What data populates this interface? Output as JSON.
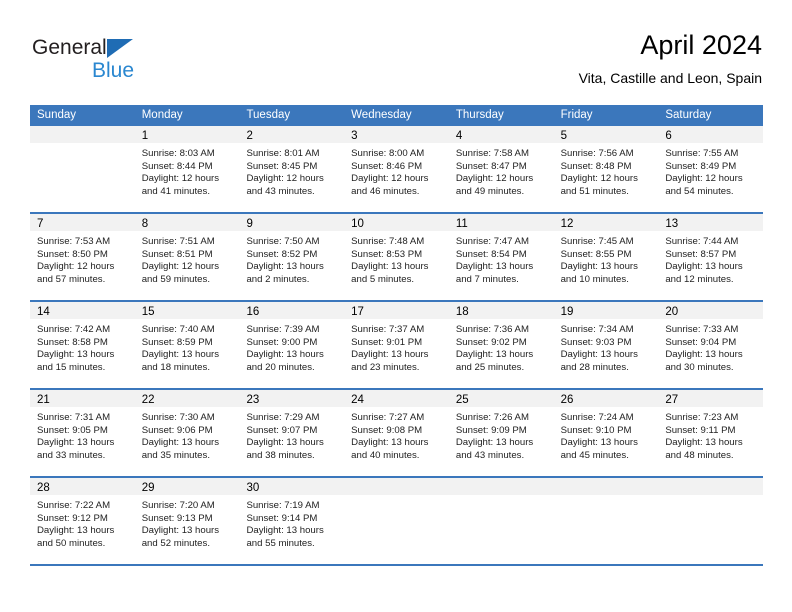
{
  "brand": {
    "name_top": "General",
    "name_bottom": "Blue"
  },
  "header": {
    "title": "April 2024",
    "location": "Vita, Castille and Leon, Spain"
  },
  "colors": {
    "header_blue": "#3b77bc",
    "logo_blue": "#2a87d0",
    "daynum_band": "#f2f2f2"
  },
  "weekdays": [
    "Sunday",
    "Monday",
    "Tuesday",
    "Wednesday",
    "Thursday",
    "Friday",
    "Saturday"
  ],
  "weeks": [
    [
      {
        "day": "",
        "lines": [
          "",
          "",
          "",
          ""
        ]
      },
      {
        "day": "1",
        "lines": [
          "Sunrise: 8:03 AM",
          "Sunset: 8:44 PM",
          "Daylight: 12 hours",
          "and 41 minutes."
        ]
      },
      {
        "day": "2",
        "lines": [
          "Sunrise: 8:01 AM",
          "Sunset: 8:45 PM",
          "Daylight: 12 hours",
          "and 43 minutes."
        ]
      },
      {
        "day": "3",
        "lines": [
          "Sunrise: 8:00 AM",
          "Sunset: 8:46 PM",
          "Daylight: 12 hours",
          "and 46 minutes."
        ]
      },
      {
        "day": "4",
        "lines": [
          "Sunrise: 7:58 AM",
          "Sunset: 8:47 PM",
          "Daylight: 12 hours",
          "and 49 minutes."
        ]
      },
      {
        "day": "5",
        "lines": [
          "Sunrise: 7:56 AM",
          "Sunset: 8:48 PM",
          "Daylight: 12 hours",
          "and 51 minutes."
        ]
      },
      {
        "day": "6",
        "lines": [
          "Sunrise: 7:55 AM",
          "Sunset: 8:49 PM",
          "Daylight: 12 hours",
          "and 54 minutes."
        ]
      }
    ],
    [
      {
        "day": "7",
        "lines": [
          "Sunrise: 7:53 AM",
          "Sunset: 8:50 PM",
          "Daylight: 12 hours",
          "and 57 minutes."
        ]
      },
      {
        "day": "8",
        "lines": [
          "Sunrise: 7:51 AM",
          "Sunset: 8:51 PM",
          "Daylight: 12 hours",
          "and 59 minutes."
        ]
      },
      {
        "day": "9",
        "lines": [
          "Sunrise: 7:50 AM",
          "Sunset: 8:52 PM",
          "Daylight: 13 hours",
          "and 2 minutes."
        ]
      },
      {
        "day": "10",
        "lines": [
          "Sunrise: 7:48 AM",
          "Sunset: 8:53 PM",
          "Daylight: 13 hours",
          "and 5 minutes."
        ]
      },
      {
        "day": "11",
        "lines": [
          "Sunrise: 7:47 AM",
          "Sunset: 8:54 PM",
          "Daylight: 13 hours",
          "and 7 minutes."
        ]
      },
      {
        "day": "12",
        "lines": [
          "Sunrise: 7:45 AM",
          "Sunset: 8:55 PM",
          "Daylight: 13 hours",
          "and 10 minutes."
        ]
      },
      {
        "day": "13",
        "lines": [
          "Sunrise: 7:44 AM",
          "Sunset: 8:57 PM",
          "Daylight: 13 hours",
          "and 12 minutes."
        ]
      }
    ],
    [
      {
        "day": "14",
        "lines": [
          "Sunrise: 7:42 AM",
          "Sunset: 8:58 PM",
          "Daylight: 13 hours",
          "and 15 minutes."
        ]
      },
      {
        "day": "15",
        "lines": [
          "Sunrise: 7:40 AM",
          "Sunset: 8:59 PM",
          "Daylight: 13 hours",
          "and 18 minutes."
        ]
      },
      {
        "day": "16",
        "lines": [
          "Sunrise: 7:39 AM",
          "Sunset: 9:00 PM",
          "Daylight: 13 hours",
          "and 20 minutes."
        ]
      },
      {
        "day": "17",
        "lines": [
          "Sunrise: 7:37 AM",
          "Sunset: 9:01 PM",
          "Daylight: 13 hours",
          "and 23 minutes."
        ]
      },
      {
        "day": "18",
        "lines": [
          "Sunrise: 7:36 AM",
          "Sunset: 9:02 PM",
          "Daylight: 13 hours",
          "and 25 minutes."
        ]
      },
      {
        "day": "19",
        "lines": [
          "Sunrise: 7:34 AM",
          "Sunset: 9:03 PM",
          "Daylight: 13 hours",
          "and 28 minutes."
        ]
      },
      {
        "day": "20",
        "lines": [
          "Sunrise: 7:33 AM",
          "Sunset: 9:04 PM",
          "Daylight: 13 hours",
          "and 30 minutes."
        ]
      }
    ],
    [
      {
        "day": "21",
        "lines": [
          "Sunrise: 7:31 AM",
          "Sunset: 9:05 PM",
          "Daylight: 13 hours",
          "and 33 minutes."
        ]
      },
      {
        "day": "22",
        "lines": [
          "Sunrise: 7:30 AM",
          "Sunset: 9:06 PM",
          "Daylight: 13 hours",
          "and 35 minutes."
        ]
      },
      {
        "day": "23",
        "lines": [
          "Sunrise: 7:29 AM",
          "Sunset: 9:07 PM",
          "Daylight: 13 hours",
          "and 38 minutes."
        ]
      },
      {
        "day": "24",
        "lines": [
          "Sunrise: 7:27 AM",
          "Sunset: 9:08 PM",
          "Daylight: 13 hours",
          "and 40 minutes."
        ]
      },
      {
        "day": "25",
        "lines": [
          "Sunrise: 7:26 AM",
          "Sunset: 9:09 PM",
          "Daylight: 13 hours",
          "and 43 minutes."
        ]
      },
      {
        "day": "26",
        "lines": [
          "Sunrise: 7:24 AM",
          "Sunset: 9:10 PM",
          "Daylight: 13 hours",
          "and 45 minutes."
        ]
      },
      {
        "day": "27",
        "lines": [
          "Sunrise: 7:23 AM",
          "Sunset: 9:11 PM",
          "Daylight: 13 hours",
          "and 48 minutes."
        ]
      }
    ],
    [
      {
        "day": "28",
        "lines": [
          "Sunrise: 7:22 AM",
          "Sunset: 9:12 PM",
          "Daylight: 13 hours",
          "and 50 minutes."
        ]
      },
      {
        "day": "29",
        "lines": [
          "Sunrise: 7:20 AM",
          "Sunset: 9:13 PM",
          "Daylight: 13 hours",
          "and 52 minutes."
        ]
      },
      {
        "day": "30",
        "lines": [
          "Sunrise: 7:19 AM",
          "Sunset: 9:14 PM",
          "Daylight: 13 hours",
          "and 55 minutes."
        ]
      },
      {
        "day": "",
        "lines": [
          "",
          "",
          "",
          ""
        ]
      },
      {
        "day": "",
        "lines": [
          "",
          "",
          "",
          ""
        ]
      },
      {
        "day": "",
        "lines": [
          "",
          "",
          "",
          ""
        ]
      },
      {
        "day": "",
        "lines": [
          "",
          "",
          "",
          ""
        ]
      }
    ]
  ]
}
